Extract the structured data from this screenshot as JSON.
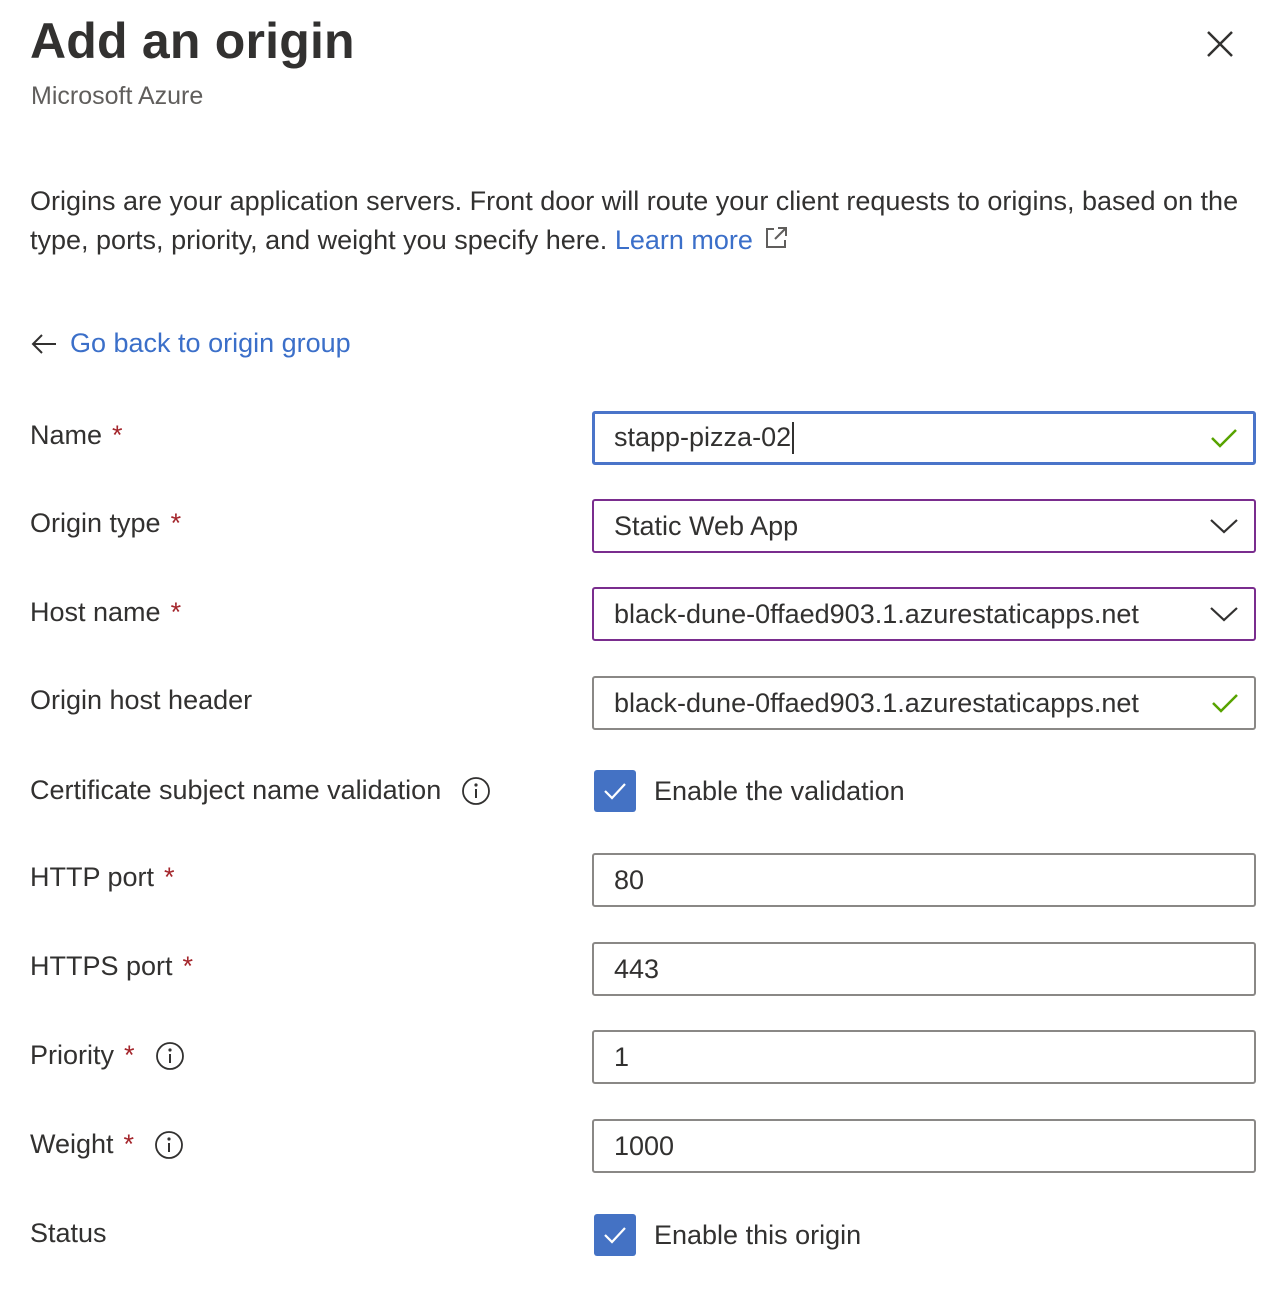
{
  "header": {
    "title": "Add an origin",
    "subtitle": "Microsoft Azure",
    "close_icon": "close-icon"
  },
  "description": {
    "text": "Origins are your application servers. Front door will route your client requests to origins, based on the type, ports, priority, and weight you specify here.",
    "link_label": "Learn more",
    "link_icon": "external-link-icon"
  },
  "back_link": {
    "label": "Go back to origin group",
    "icon": "arrow-left-icon"
  },
  "form": {
    "name": {
      "label": "Name",
      "required_mark": "*",
      "value": "stapp-pizza-02",
      "validation_icon": "checkmark-icon"
    },
    "origin_type": {
      "label": "Origin type",
      "required_mark": "*",
      "value": "Static Web App",
      "icon": "chevron-down-icon"
    },
    "host_name": {
      "label": "Host name",
      "required_mark": "*",
      "value": "black-dune-0ffaed903.1.azurestaticapps.net",
      "icon": "chevron-down-icon"
    },
    "origin_host_header": {
      "label": "Origin host header",
      "value": "black-dune-0ffaed903.1.azurestaticapps.net",
      "validation_icon": "checkmark-icon"
    },
    "cert_validation": {
      "label": "Certificate subject name validation",
      "info_icon": "info-icon",
      "checkbox_label": "Enable the validation",
      "checked": true
    },
    "http_port": {
      "label": "HTTP port",
      "required_mark": "*",
      "value": "80"
    },
    "https_port": {
      "label": "HTTPS port",
      "required_mark": "*",
      "value": "443"
    },
    "priority": {
      "label": "Priority",
      "required_mark": "*",
      "info_icon": "info-icon",
      "value": "1"
    },
    "weight": {
      "label": "Weight",
      "required_mark": "*",
      "info_icon": "info-icon",
      "value": "1000"
    },
    "status": {
      "label": "Status",
      "checkbox_label": "Enable this origin",
      "checked": true
    }
  },
  "colors": {
    "link": "#3b6fc9",
    "required": "#a4262c",
    "focus_border": "#4a74c9",
    "select_border": "#7a2d8e",
    "checkbox_fill": "#4472c4",
    "valid_check": "#57a300"
  }
}
